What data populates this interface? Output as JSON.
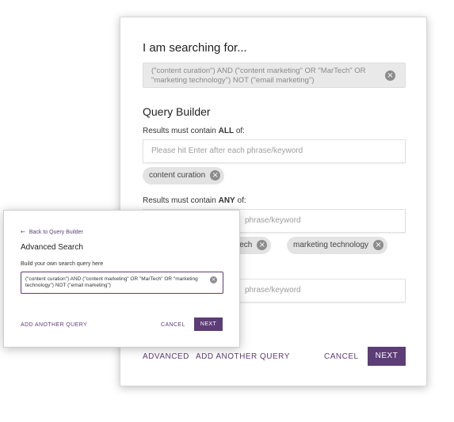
{
  "main": {
    "heading": "I am searching for...",
    "query_text": "(\"content curation\") AND (\"content marketing\" OR \"MarTech\" OR \"marketing technology\") NOT (\"email marketing\")",
    "builder_title": "Query Builder",
    "all_label_prefix": "Results must contain ",
    "all_label_strong": "ALL",
    "all_label_suffix": " of:",
    "all_placeholder": "Please hit Enter after each phrase/keyword",
    "all_chips": [
      "content curation"
    ],
    "any_label_prefix": "Results must contain ",
    "any_label_strong": "ANY",
    "any_label_suffix": " of:",
    "any_placeholder": "phrase/keyword",
    "any_chips": [
      "MarTech",
      "marketing technology"
    ],
    "none_placeholder": "phrase/keyword",
    "advanced_label": "ADVANCED",
    "add_query_label": "ADD ANOTHER QUERY",
    "cancel_label": "CANCEL",
    "next_label": "NEXT"
  },
  "advanced": {
    "back_label": "Back to Query Builder",
    "title": "Advanced Search",
    "subtitle": "Build your own search query here",
    "query_text": "(\"content curation\") AND (\"content marketing\" OR \"MarTech\" OR \"marketing technology\") NOT (\"email marketing\")",
    "add_query_label": "ADD ANOTHER QUERY",
    "cancel_label": "CANCEL",
    "next_label": "NEXT"
  },
  "icons": {
    "clear": "close-circle-icon",
    "back": "arrow-left-icon"
  },
  "colors": {
    "accent": "#5c3d77",
    "chip_bg": "#e3e3e3",
    "disabled_bg": "#e9e9e9"
  }
}
